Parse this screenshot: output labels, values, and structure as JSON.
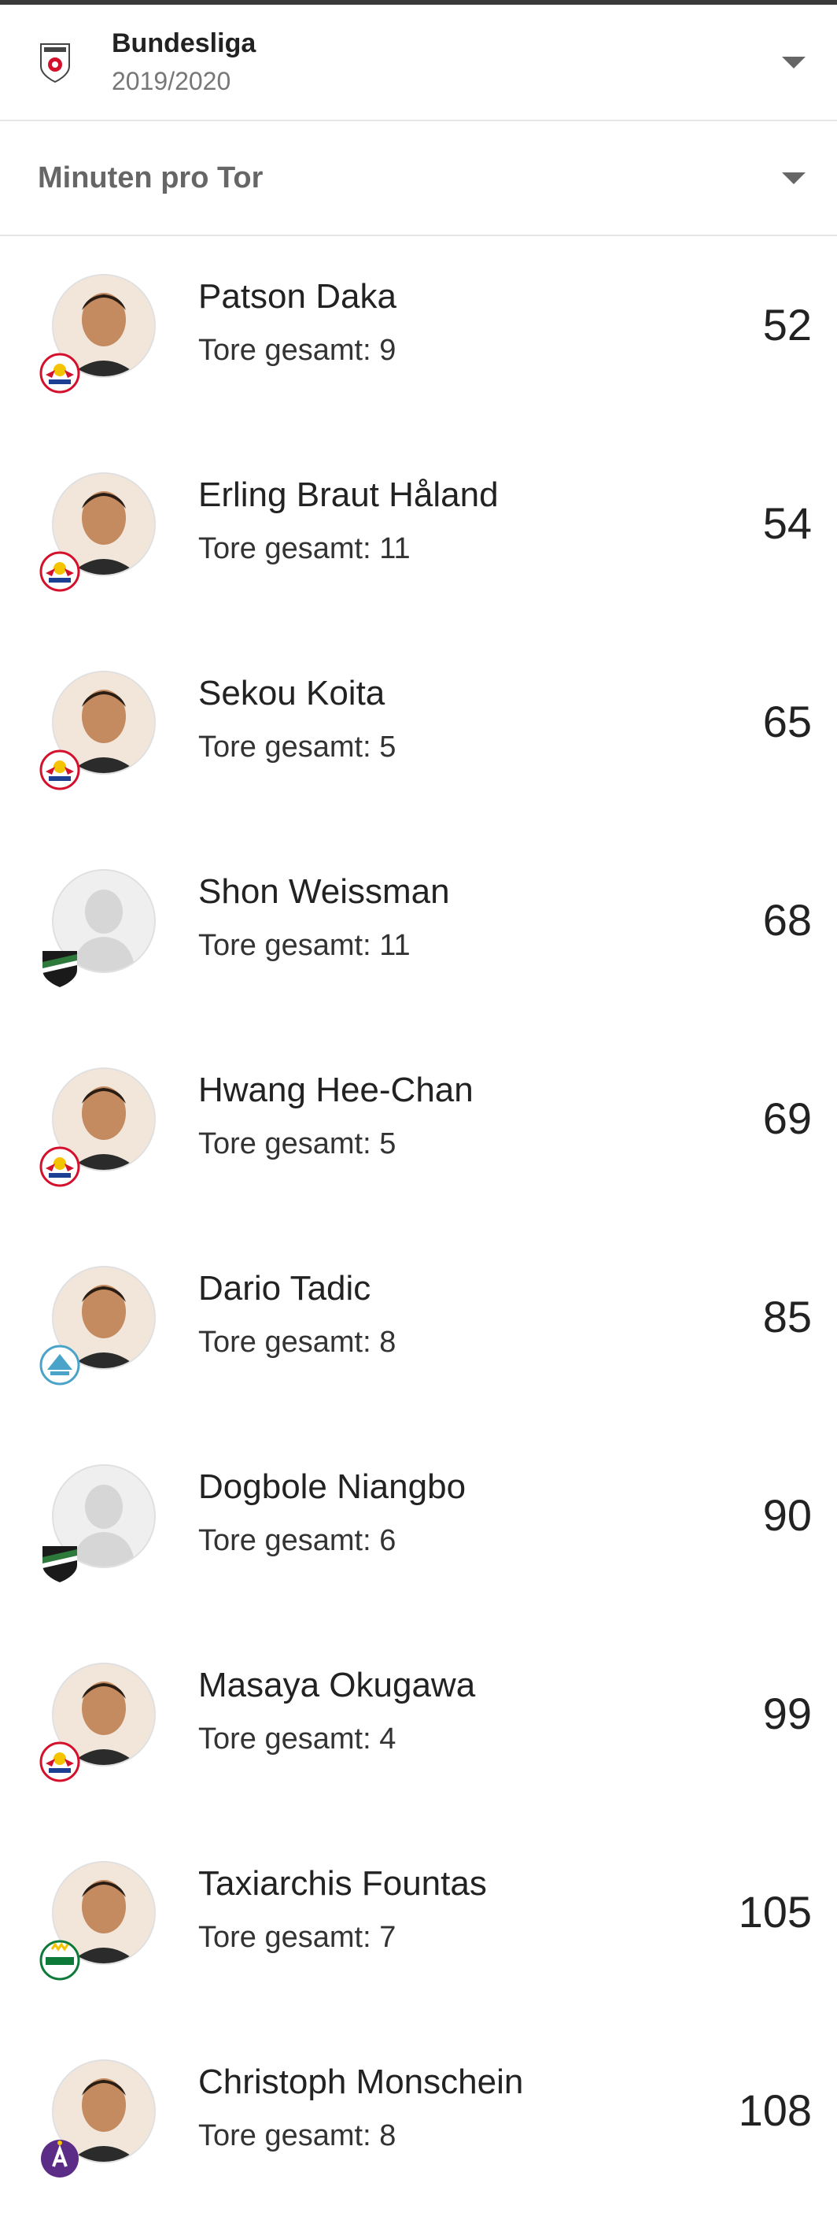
{
  "header": {
    "league_name": "Bundesliga",
    "season": "2019/2020",
    "metric": "Minuten pro Tor"
  },
  "players": [
    {
      "name": "Patson Daka",
      "goals_text": "Tore gesamt: 9",
      "value": "52",
      "club_icon": "salzburg-crest",
      "photo": "player-photo"
    },
    {
      "name": "Erling Braut Håland",
      "goals_text": "Tore gesamt: 11",
      "value": "54",
      "club_icon": "salzburg-crest",
      "photo": "player-photo"
    },
    {
      "name": "Sekou Koita",
      "goals_text": "Tore gesamt: 5",
      "value": "65",
      "club_icon": "salzburg-crest",
      "photo": "player-photo"
    },
    {
      "name": "Shon Weissman",
      "goals_text": "Tore gesamt: 11",
      "value": "68",
      "club_icon": "wac-crest",
      "photo": "placeholder"
    },
    {
      "name": "Hwang Hee-Chan",
      "goals_text": "Tore gesamt: 5",
      "value": "69",
      "club_icon": "salzburg-crest",
      "photo": "player-photo"
    },
    {
      "name": "Dario Tadic",
      "goals_text": "Tore gesamt: 8",
      "value": "85",
      "club_icon": "hartberg-crest",
      "photo": "player-photo"
    },
    {
      "name": "Dogbole Niangbo",
      "goals_text": "Tore gesamt: 6",
      "value": "90",
      "club_icon": "wac-crest",
      "photo": "placeholder"
    },
    {
      "name": "Masaya Okugawa",
      "goals_text": "Tore gesamt: 4",
      "value": "99",
      "club_icon": "salzburg-crest",
      "photo": "player-photo"
    },
    {
      "name": "Taxiarchis Fountas",
      "goals_text": "Tore gesamt: 7",
      "value": "105",
      "club_icon": "rapid-crest",
      "photo": "player-photo"
    },
    {
      "name": "Christoph Monschein",
      "goals_text": "Tore gesamt: 8",
      "value": "108",
      "club_icon": "austria-crest",
      "photo": "player-photo"
    }
  ],
  "colors": {
    "divider": "#e6e6e6",
    "muted_text": "#777777",
    "salzburg_red": "#d4112c",
    "wac_black": "#1a1a1a",
    "hartberg_blue": "#4aa3c8",
    "rapid_green": "#0d7a3a",
    "austria_violet": "#5b2d86"
  }
}
